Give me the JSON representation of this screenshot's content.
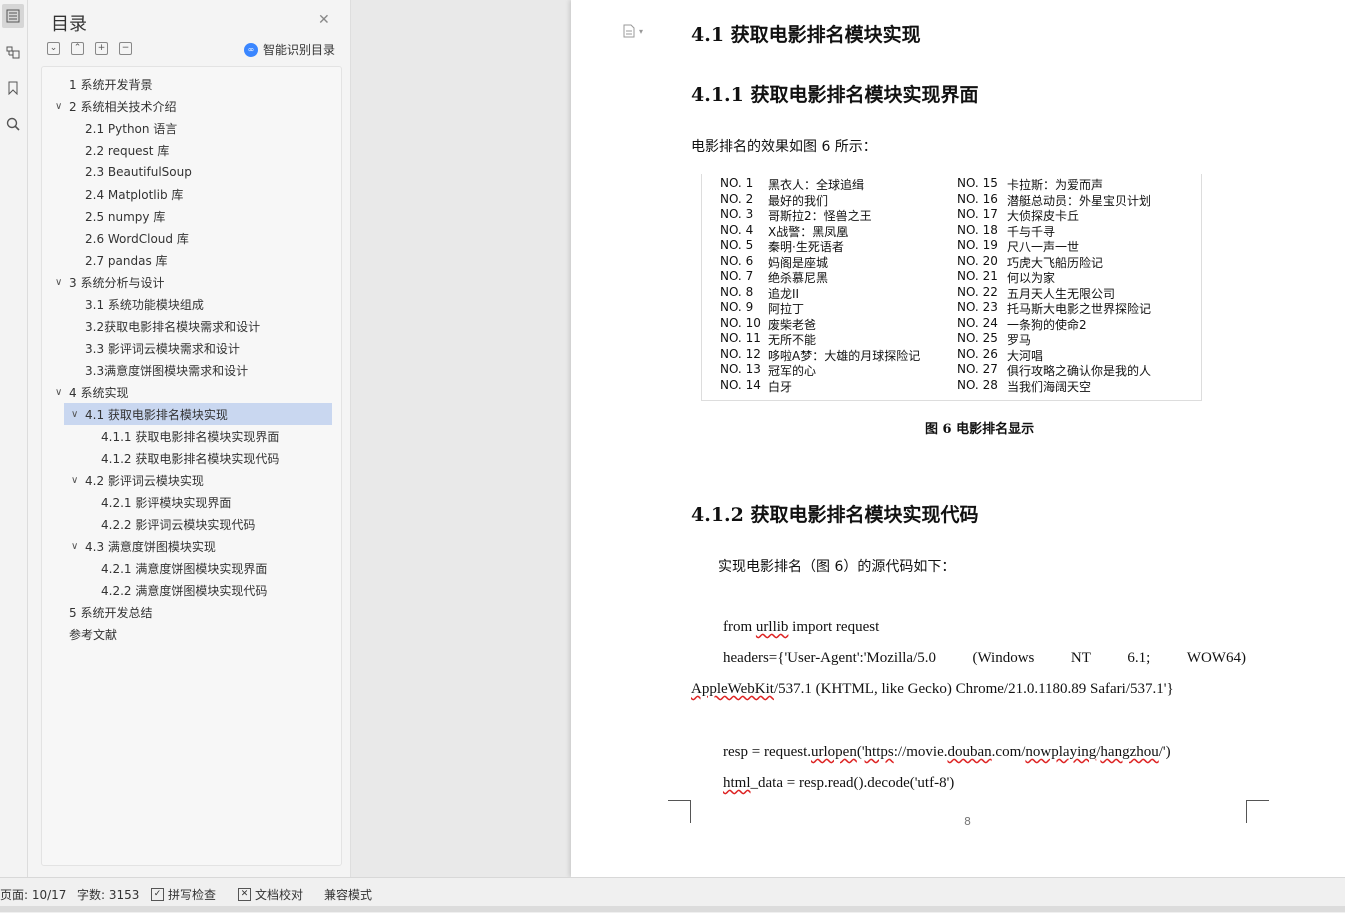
{
  "rail": {
    "icons": [
      "toc-icon",
      "navigation-icon",
      "bookmark-icon",
      "search-icon"
    ]
  },
  "toc": {
    "title": "目录",
    "smart_label": "智能识别目录",
    "items": [
      {
        "label": "1 系统开发背景",
        "level": 1,
        "expand": ""
      },
      {
        "label": "2 系统相关技术介绍",
        "level": 1,
        "expand": "v"
      },
      {
        "label": "2.1 Python 语言",
        "level": 2,
        "expand": ""
      },
      {
        "label": "2.2 request 库",
        "level": 2,
        "expand": ""
      },
      {
        "label": "2.3 BeautifulSoup",
        "level": 2,
        "expand": ""
      },
      {
        "label": "2.4 Matplotlib 库",
        "level": 2,
        "expand": ""
      },
      {
        "label": "2.5 numpy 库",
        "level": 2,
        "expand": ""
      },
      {
        "label": "2.6 WordCloud 库",
        "level": 2,
        "expand": ""
      },
      {
        "label": "2.7 pandas 库",
        "level": 2,
        "expand": ""
      },
      {
        "label": "3 系统分析与设计",
        "level": 1,
        "expand": "v"
      },
      {
        "label": "3.1 系统功能模块组成",
        "level": 2,
        "expand": ""
      },
      {
        "label": "3.2获取电影排名模块需求和设计",
        "level": 2,
        "expand": ""
      },
      {
        "label": "3.3 影评词云模块需求和设计",
        "level": 2,
        "expand": ""
      },
      {
        "label": "3.3满意度饼图模块需求和设计",
        "level": 2,
        "expand": ""
      },
      {
        "label": "4 系统实现",
        "level": 1,
        "expand": "v"
      },
      {
        "label": "4.1  获取电影排名模块实现",
        "level": 2,
        "expand": "v",
        "selected": true
      },
      {
        "label": "4.1.1  获取电影排名模块实现界面",
        "level": 3,
        "expand": ""
      },
      {
        "label": "4.1.2  获取电影排名模块实现代码",
        "level": 3,
        "expand": ""
      },
      {
        "label": "4.2  影评词云模块实现",
        "level": 2,
        "expand": "v"
      },
      {
        "label": "4.2.1  影评模块实现界面",
        "level": 3,
        "expand": ""
      },
      {
        "label": "4.2.2  影评词云模块实现代码",
        "level": 3,
        "expand": ""
      },
      {
        "label": "4.3  满意度饼图模块实现",
        "level": 2,
        "expand": "v"
      },
      {
        "label": "4.2.1  满意度饼图模块实现界面",
        "level": 3,
        "expand": ""
      },
      {
        "label": "4.2.2  满意度饼图模块实现代码",
        "level": 3,
        "expand": ""
      },
      {
        "label": "5 系统开发总结",
        "level": 1,
        "expand": ""
      },
      {
        "label": "参考文献",
        "level": 1,
        "expand": ""
      }
    ]
  },
  "doc": {
    "h_41": "4.1  获取电影排名模块实现",
    "h_411": "4.1.1  获取电影排名模块实现界面",
    "intro": "电影排名的效果如图 6 所示：",
    "figure_caption": "图 6  电影排名显示",
    "h_412": "4.1.2  获取电影排名模块实现代码",
    "code_intro": "实现电影排名（图 6）的源代码如下：",
    "page_number": "8",
    "rankings_left": [
      {
        "no": "NO. 1",
        "title": "黑衣人：全球追缉"
      },
      {
        "no": "NO. 2",
        "title": "最好的我们"
      },
      {
        "no": "NO. 3",
        "title": "哥斯拉2：怪兽之王"
      },
      {
        "no": "NO. 4",
        "title": "X战警：黑凤凰"
      },
      {
        "no": "NO. 5",
        "title": "秦明·生死语者"
      },
      {
        "no": "NO. 6",
        "title": "妈阁是座城"
      },
      {
        "no": "NO. 7",
        "title": "绝杀慕尼黑"
      },
      {
        "no": "NO. 8",
        "title": "追龙II"
      },
      {
        "no": "NO. 9",
        "title": "阿拉丁"
      },
      {
        "no": "NO. 10",
        "title": "废柴老爸"
      },
      {
        "no": "NO. 11",
        "title": "无所不能"
      },
      {
        "no": "NO. 12",
        "title": "哆啦A梦：大雄的月球探险记"
      },
      {
        "no": "NO. 13",
        "title": "冠军的心"
      },
      {
        "no": "NO. 14",
        "title": "白牙"
      }
    ],
    "rankings_right": [
      {
        "no": "NO. 15",
        "title": "卡拉斯：为爱而声"
      },
      {
        "no": "NO. 16",
        "title": "潜艇总动员：外星宝贝计划"
      },
      {
        "no": "NO. 17",
        "title": "大侦探皮卡丘"
      },
      {
        "no": "NO. 18",
        "title": "千与千寻"
      },
      {
        "no": "NO. 19",
        "title": "尺八一声一世"
      },
      {
        "no": "NO. 20",
        "title": "巧虎大飞船历险记"
      },
      {
        "no": "NO. 21",
        "title": "何以为家"
      },
      {
        "no": "NO. 22",
        "title": "五月天人生无限公司"
      },
      {
        "no": "NO. 23",
        "title": "托马斯大电影之世界探险记"
      },
      {
        "no": "NO. 24",
        "title": "一条狗的使命2"
      },
      {
        "no": "NO. 25",
        "title": "罗马"
      },
      {
        "no": "NO. 26",
        "title": "大河唱"
      },
      {
        "no": "NO. 27",
        "title": "俱行攻略之确认你是我的人"
      },
      {
        "no": "NO. 28",
        "title": "当我们海阔天空"
      }
    ]
  },
  "status": {
    "page": "页面: 10/17",
    "words": "字数: 3153",
    "spell": "拼写检查",
    "proof": "文档校对",
    "compat": "兼容模式"
  }
}
